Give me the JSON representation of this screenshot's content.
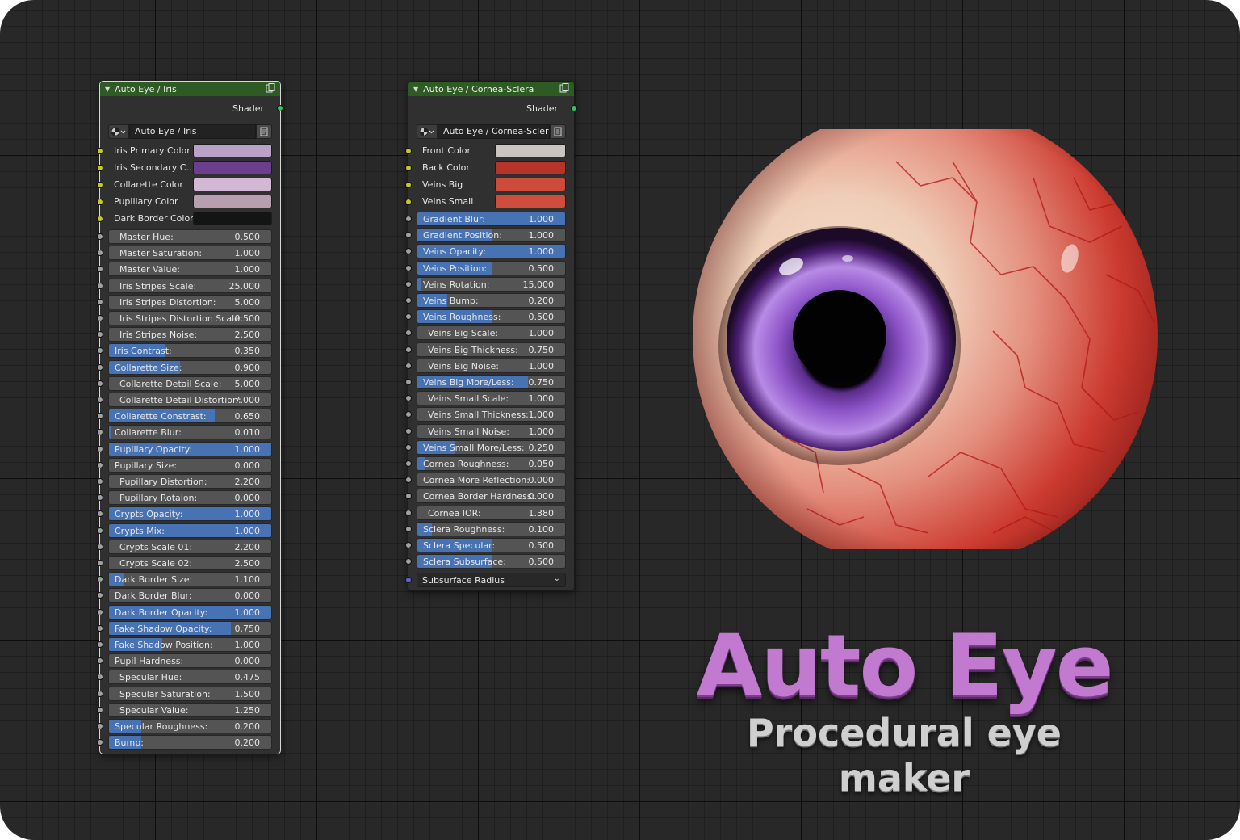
{
  "iris_node": {
    "title": "Auto Eye / Iris",
    "output": "Shader",
    "node_tree": "Auto Eye / Iris",
    "color_inputs": [
      {
        "label": "Iris Primary Color",
        "color": "#b9a1c8"
      },
      {
        "label": "Iris Secondary C..",
        "color": "#6b3f8e"
      },
      {
        "label": "Collarette Color",
        "color": "#d3b8d6"
      },
      {
        "label": "Pupillary Color",
        "color": "#b89fb0"
      },
      {
        "label": "Dark Border Color",
        "color": "#141414"
      }
    ],
    "sliders": [
      {
        "label": "Master Hue:",
        "value": "0.500",
        "fill": 0,
        "indent": true
      },
      {
        "label": "Master Saturation:",
        "value": "1.000",
        "fill": 0,
        "indent": true
      },
      {
        "label": "Master Value:",
        "value": "1.000",
        "fill": 0,
        "indent": true
      },
      {
        "label": "Iris Stripes Scale:",
        "value": "25.000",
        "fill": 0,
        "indent": true
      },
      {
        "label": "Iris Stripes Distortion:",
        "value": "5.000",
        "fill": 0,
        "indent": true
      },
      {
        "label": "Iris Stripes Distortion Scale:",
        "value": "0.500",
        "fill": 0,
        "indent": true
      },
      {
        "label": "Iris Stripes Noise:",
        "value": "2.500",
        "fill": 0,
        "indent": true
      },
      {
        "label": "Iris Contrast:",
        "value": "0.350",
        "fill": 0.35,
        "indent": false
      },
      {
        "label": "Collarette Size:",
        "value": "0.900",
        "fill": 0.44,
        "indent": false
      },
      {
        "label": "Collarette Detail Scale:",
        "value": "5.000",
        "fill": 0,
        "indent": true
      },
      {
        "label": "Collarette Detail Distortion:",
        "value": "7.000",
        "fill": 0,
        "indent": true
      },
      {
        "label": "Collarette Constrast:",
        "value": "0.650",
        "fill": 0.65,
        "indent": false
      },
      {
        "label": "Collarette Blur:",
        "value": "0.010",
        "fill": 0.01,
        "indent": false
      },
      {
        "label": "Pupillary Opacity:",
        "value": "1.000",
        "fill": 1,
        "indent": false
      },
      {
        "label": "Pupillary Size:",
        "value": "0.000",
        "fill": 0,
        "indent": false
      },
      {
        "label": "Pupillary Distortion:",
        "value": "2.200",
        "fill": 0,
        "indent": true
      },
      {
        "label": "Pupillary Rotaion:",
        "value": "0.000",
        "fill": 0,
        "indent": true
      },
      {
        "label": "Crypts Opacity:",
        "value": "1.000",
        "fill": 1,
        "indent": false
      },
      {
        "label": "Crypts Mix:",
        "value": "1.000",
        "fill": 1,
        "indent": false
      },
      {
        "label": "Crypts Scale 01:",
        "value": "2.200",
        "fill": 0,
        "indent": true
      },
      {
        "label": "Crypts Scale 02:",
        "value": "2.500",
        "fill": 0,
        "indent": true
      },
      {
        "label": "Dark Border Size:",
        "value": "1.100",
        "fill": 0.09,
        "indent": false
      },
      {
        "label": "Dark Border Blur:",
        "value": "0.000",
        "fill": 0,
        "indent": false
      },
      {
        "label": "Dark Border Opacity:",
        "value": "1.000",
        "fill": 1,
        "indent": false
      },
      {
        "label": "Fake Shadow Opacity:",
        "value": "0.750",
        "fill": 0.75,
        "indent": false
      },
      {
        "label": "Fake Shadow Position:",
        "value": "1.000",
        "fill": 0.33,
        "indent": false
      },
      {
        "label": "Pupil Hardness:",
        "value": "0.000",
        "fill": 0,
        "indent": false
      },
      {
        "label": "Specular Hue:",
        "value": "0.475",
        "fill": 0,
        "indent": true
      },
      {
        "label": "Specular Saturation:",
        "value": "1.500",
        "fill": 0,
        "indent": true
      },
      {
        "label": "Specular Value:",
        "value": "1.250",
        "fill": 0,
        "indent": true
      },
      {
        "label": "Specular Roughness:",
        "value": "0.200",
        "fill": 0.2,
        "indent": false
      },
      {
        "label": "Bump:",
        "value": "0.200",
        "fill": 0.2,
        "indent": false
      }
    ]
  },
  "sclera_node": {
    "title": "Auto Eye / Cornea-Sclera",
    "output": "Shader",
    "node_tree": "Auto Eye / Cornea-Sclera",
    "color_inputs": [
      {
        "label": "Front Color",
        "color": "#cac5bf"
      },
      {
        "label": "Back Color",
        "color": "#b7342a"
      },
      {
        "label": "Veins Big",
        "color": "#cc4b3a"
      },
      {
        "label": "Veins Small",
        "color": "#cf4d3c"
      }
    ],
    "sliders": [
      {
        "label": "Gradient Blur:",
        "value": "1.000",
        "fill": 1,
        "indent": false
      },
      {
        "label": "Gradient Position:",
        "value": "1.000",
        "fill": 0.5,
        "indent": false
      },
      {
        "label": "Veins Opacity:",
        "value": "1.000",
        "fill": 1,
        "indent": false
      },
      {
        "label": "Veins Position:",
        "value": "0.500",
        "fill": 0.5,
        "indent": false
      },
      {
        "label": "Veins Rotation:",
        "value": "15.000",
        "fill": 0.03,
        "indent": false
      },
      {
        "label": "Veins Bump:",
        "value": "0.200",
        "fill": 0.2,
        "indent": false
      },
      {
        "label": "Veins Roughness:",
        "value": "0.500",
        "fill": 0.5,
        "indent": false
      },
      {
        "label": "Veins Big Scale:",
        "value": "1.000",
        "fill": 0,
        "indent": true
      },
      {
        "label": "Veins Big Thickness:",
        "value": "0.750",
        "fill": 0,
        "indent": true
      },
      {
        "label": "Veins Big Noise:",
        "value": "1.000",
        "fill": 0,
        "indent": true
      },
      {
        "label": "Veins Big More/Less:",
        "value": "0.750",
        "fill": 0.75,
        "indent": false
      },
      {
        "label": "Veins Small  Scale:",
        "value": "1.000",
        "fill": 0,
        "indent": true
      },
      {
        "label": "Veins Small Thickness:",
        "value": "1.000",
        "fill": 0,
        "indent": true
      },
      {
        "label": "Veins Small Noise:",
        "value": "1.000",
        "fill": 0,
        "indent": true
      },
      {
        "label": "Veins Small More/Less:",
        "value": "0.250",
        "fill": 0.25,
        "indent": false
      },
      {
        "label": "Cornea Roughness:",
        "value": "0.050",
        "fill": 0.05,
        "indent": false
      },
      {
        "label": "Cornea More Reflection:",
        "value": "0.000",
        "fill": 0,
        "indent": false
      },
      {
        "label": "Cornea Border Hardness:",
        "value": "0.000",
        "fill": 0,
        "indent": false
      },
      {
        "label": "Cornea IOR:",
        "value": "1.380",
        "fill": 0,
        "indent": true
      },
      {
        "label": "Sclera Roughness:",
        "value": "0.100",
        "fill": 0.1,
        "indent": false
      },
      {
        "label": "Sclera Specular:",
        "value": "0.500",
        "fill": 0.5,
        "indent": false
      },
      {
        "label": "Sclera Subsurface:",
        "value": "0.500",
        "fill": 0.5,
        "indent": false
      }
    ],
    "dropdown": {
      "label": "Subsurface Radius"
    }
  },
  "brand": {
    "title": "Auto Eye",
    "subtitle": "Procedural eye maker"
  },
  "colors": {
    "accent_blue": "#4772b3",
    "header_green": "#2e5a23",
    "brand_purple": "#c27ad0"
  }
}
